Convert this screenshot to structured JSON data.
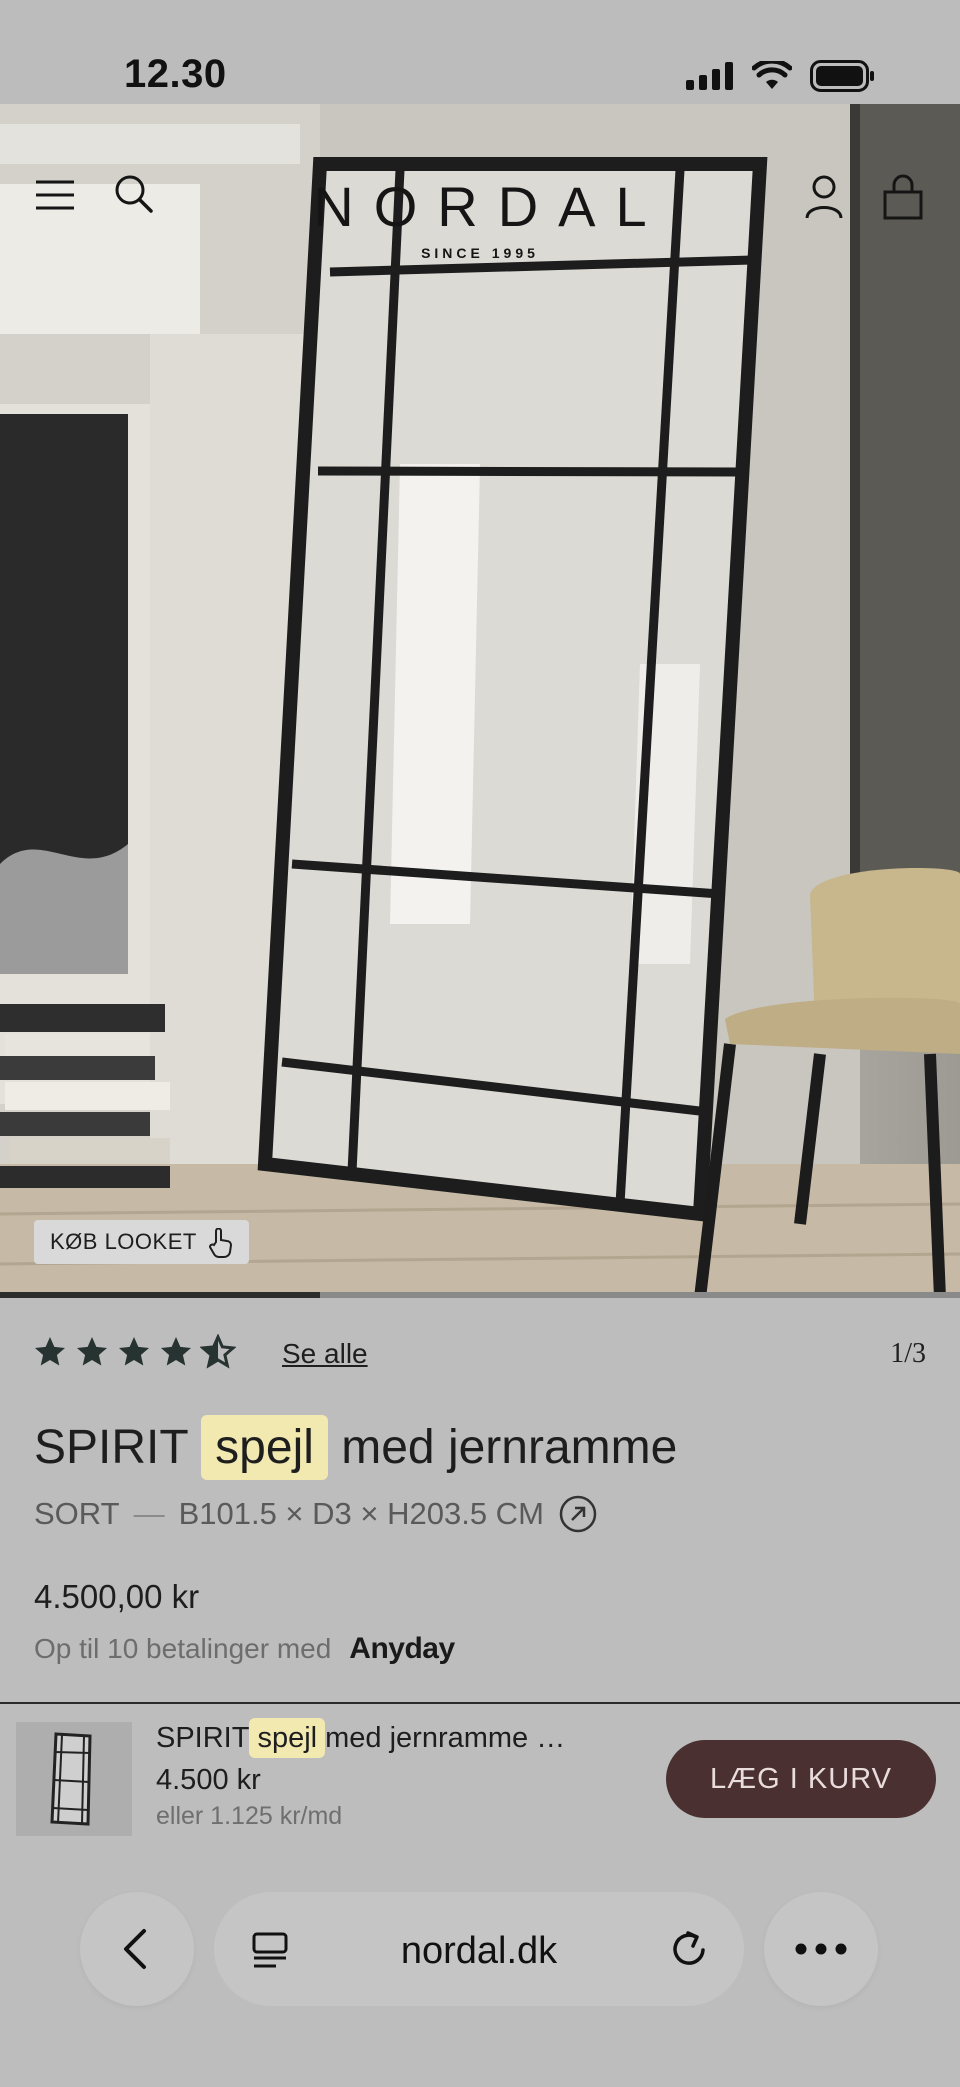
{
  "status_bar": {
    "time": "12.30"
  },
  "header": {
    "logo": "NORDAL",
    "tagline": "SINCE 1995"
  },
  "hero": {
    "look_button": "KØB LOOKET",
    "slide_progress": 0.333
  },
  "product": {
    "rating": 4.5,
    "see_all": "Se alle",
    "pager": "1/3",
    "title_before": "SPIRIT",
    "title_highlight": "spejl",
    "title_after": "med jernramme",
    "color": "SORT",
    "variant_sep": "—",
    "dimensions": "B101.5 × D3 × H203.5 CM",
    "price": "4.500,00 kr",
    "installments_text": "Op til 10 betalinger med",
    "installments_brand": "Anyday"
  },
  "sticky_bar": {
    "title_before": "SPIRIT",
    "title_highlight": "spejl",
    "title_after": "med jernramme …",
    "price": "4.500 kr",
    "monthly": "eller 1.125 kr/md",
    "button": "LÆG I KURV"
  },
  "browser": {
    "url": "nordal.dk"
  },
  "colors": {
    "button_bg": "#4a3030",
    "highlight": "#f2e9b0",
    "page_bg": "#bdbdbd"
  }
}
